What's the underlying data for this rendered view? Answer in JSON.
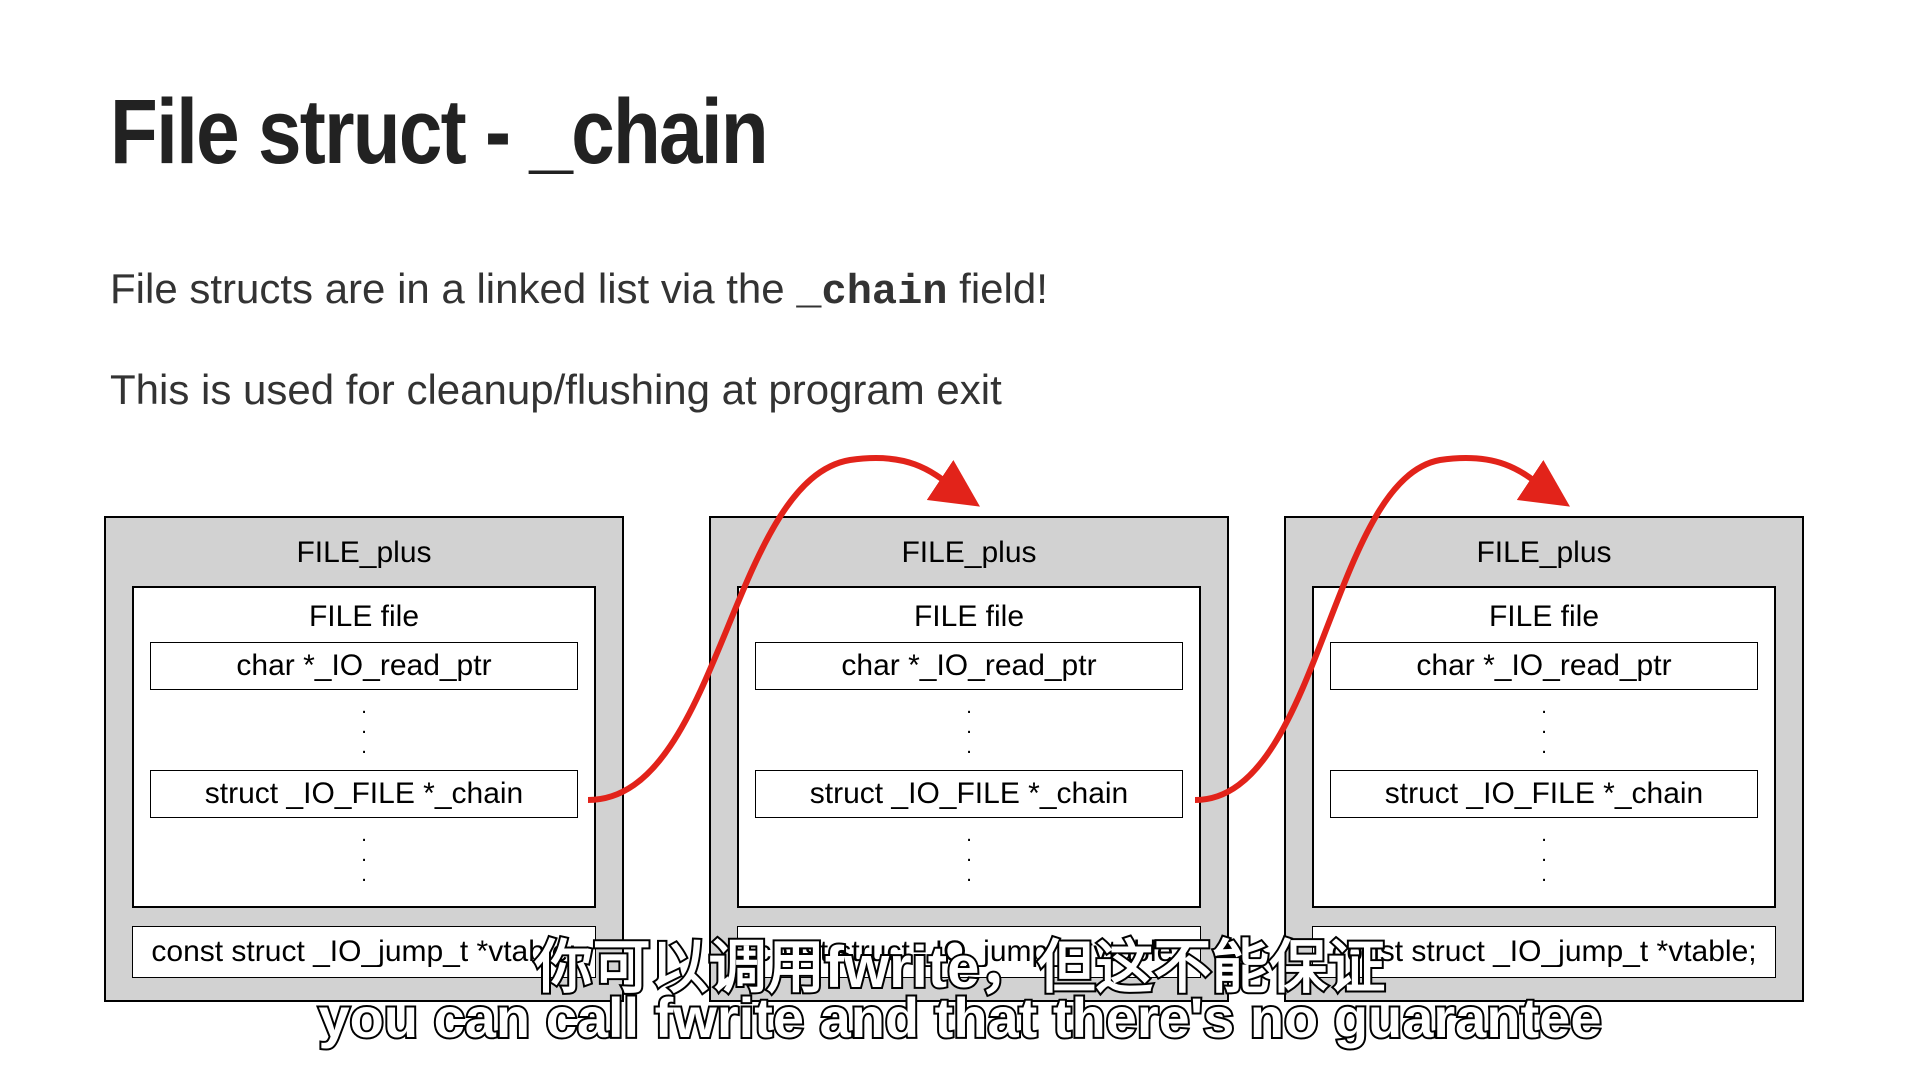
{
  "title": "File struct - _chain",
  "body_line1_pre": "File structs are in a linked list via the ",
  "body_line1_code": "_chain",
  "body_line1_post": " field!",
  "body_line2": "This is used for cleanup/flushing at program exit",
  "struct": {
    "outer_title": "FILE_plus",
    "inner_title": "FILE file",
    "field1": "char *_IO_read_ptr",
    "field_chain": "struct _IO_FILE *_chain",
    "vtable": "const struct _IO_jump_t *vtable;"
  },
  "subtitle_zh": "你可以调用fwrite，但这不能保证",
  "subtitle_en": "you can call fwrite and that there's no guarantee"
}
